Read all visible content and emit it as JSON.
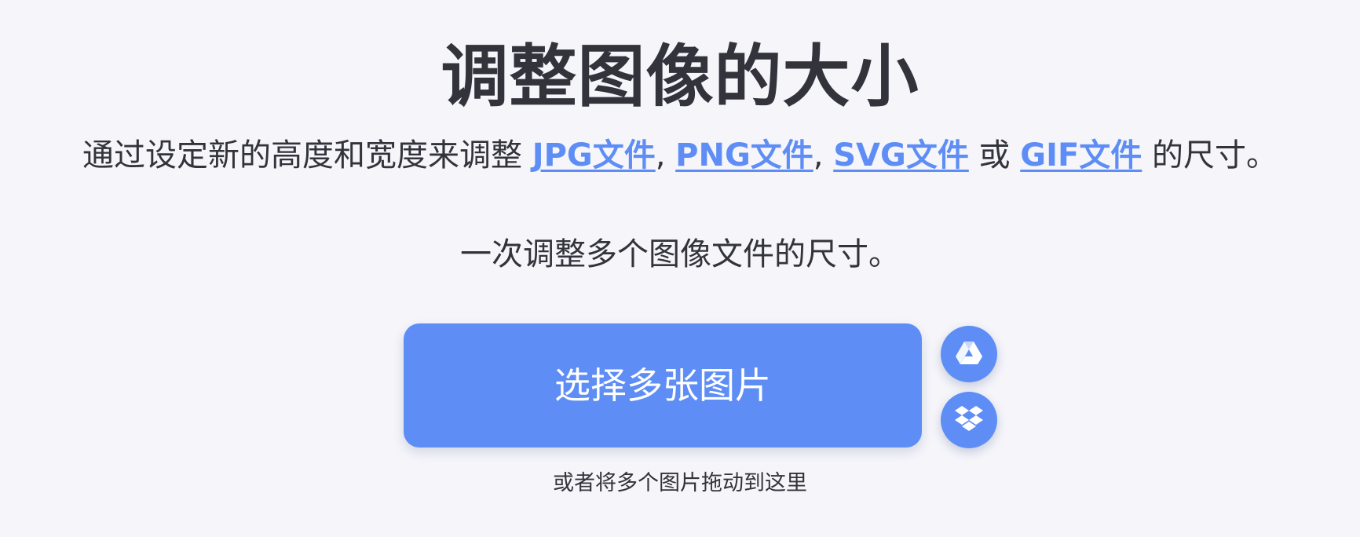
{
  "hero": {
    "title": "调整图像的大小",
    "description": {
      "intro": "通过设定新的高度和宽度来调整 ",
      "links": [
        {
          "label": "JPG文件"
        },
        {
          "label": "PNG文件"
        },
        {
          "label": "SVG文件"
        },
        {
          "label": "GIF文件"
        }
      ],
      "separator": ", ",
      "conjunction": " 或 ",
      "outro": " 的尺寸。"
    },
    "subline": "一次调整多个图像文件的尺寸。"
  },
  "upload": {
    "button_label": "选择多张图片",
    "drive_icon": "google-drive-icon",
    "dropbox_icon": "dropbox-icon",
    "hint": "或者将多个图片拖动到这里"
  },
  "colors": {
    "background": "#f5f5fa",
    "accent": "#5e8ef5",
    "text": "#33333b"
  }
}
